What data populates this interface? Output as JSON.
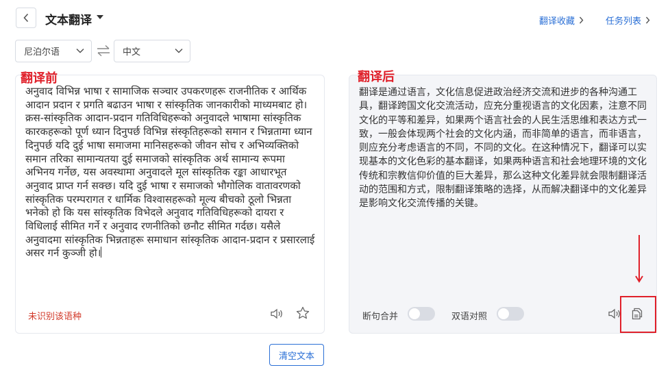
{
  "header": {
    "title": "文本翻译",
    "links": [
      {
        "label": "翻译收藏"
      },
      {
        "label": "任务列表"
      }
    ]
  },
  "languages": {
    "source": "尼泊尔语",
    "target": "中文"
  },
  "annotations": {
    "before": "翻译前",
    "after": "翻译后"
  },
  "source_panel": {
    "text": "अनुवाद विभिन्न भाषा र सामाजिक सञ्चार उपकरणहरू राजनीतिक र आर्थिक आदान प्रदान र प्रगति बढाउन भाषा र सांस्कृतिक जानकारीको माध्यमबाट हो। क्रस-सांस्कृतिक आदान-प्रदान गतिविधिहरूको अनुवादले भाषामा सांस्कृतिक कारकहरूको पूर्ण ध्यान दिनुपर्छ विभिन्न संस्कृतिहरूको समान र भिन्नतामा ध्यान दिनुपर्छ यदि दुई भाषा समाजमा मानिसहरूको जीवन सोच र अभिव्यक्तिको समान तरिका सामान्यतया दुई समाजको सांस्कृतिक अर्थ सामान्य रूपमा अभिनय गर्नेछ, यस अवस्थामा अनुवादले मूल सांस्कृतिक रङ्का आधारभूत अनुवाद प्राप्त गर्न सक्छ। यदि दुई भाषा र समाजको भौगोलिक वातावरणको सांस्कृतिक परम्परागत र धार्मिक विश्वासहरूको मूल्य बीचको ठूलो भिन्नता भनेको हो कि यस सांस्कृतिक विभेदले अनुवाद गतिविधिहरूको दायरा र विधिलाई सीमित गर्ने र अनुवाद रणनीतिको छनौट सीमित गर्दछ। यसैले अनुवादमा सांस्कृतिक भिन्नताहरू समाधान सांस्कृतिक आदान-प्रदान र प्रसारलाई असर गर्न कुञ्जी हो।",
    "status": "未识别该语种"
  },
  "target_panel": {
    "text": "翻译是通过语言，文化信息促进政治经济交流和进步的各种沟通工具，翻译跨国文化交流活动，应充分重视语言的文化因素，注意不同文化的平等和差异，如果两个语言社会的人民生活思维和表达方式一致，一般会体现两个社会的文化内涵，而非简单的语言，而非语言，则应充分考虑语言的不同，不同的文化。在这种情况下，翻译可以实现基本的文化色彩的基本翻译，如果两种语言和社会地理环境的文化传统和宗教信仰价值的巨大差异，那么这种文化差异就会限制翻译活动的范围和方式，限制翻译策略的选择，从而解决翻译中的文化差异是影响文化交流传播的关键。",
    "toggles": [
      {
        "label": "断句合并",
        "on": false
      },
      {
        "label": "双语对照",
        "on": false
      }
    ]
  },
  "actions": {
    "clear": "清空文本"
  },
  "colors": {
    "accent": "#2a6fd6",
    "annotation": "#e0202a"
  }
}
